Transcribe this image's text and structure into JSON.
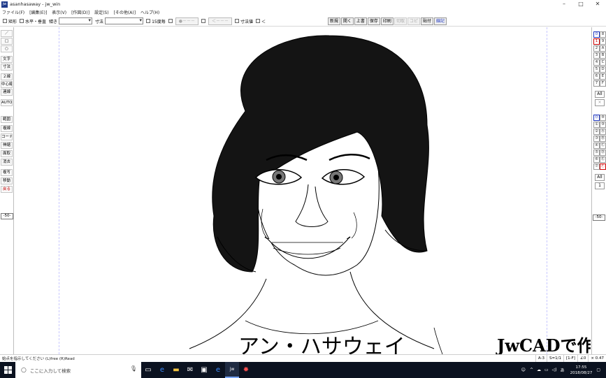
{
  "window": {
    "app_icon_label": "jw",
    "title": "asanhasaway - jw_win",
    "controls": [
      "–",
      "□",
      "✕"
    ]
  },
  "menu": [
    "ファイル(F)",
    "[編集(E)]",
    "表示(V)",
    "[作図(D)]",
    "設定(S)",
    "[その他(A)]",
    "ヘルプ(H)"
  ],
  "toolbar": {
    "rect_label": "矩形",
    "horiz_vert_label": "水平・垂直",
    "tilt_label": "傾き",
    "dim_label": "寸法",
    "deg15_label": "15度毎",
    "btn_disabled_1": "●－－－",
    "btn_disabled_2": "＜－－－",
    "dimvalue_label": "寸法値",
    "lt_label": "＜",
    "buttons": [
      {
        "label": "新規",
        "state": "normal"
      },
      {
        "label": "開く",
        "state": "normal"
      },
      {
        "label": "上書",
        "state": "normal"
      },
      {
        "label": "保存",
        "state": "normal"
      },
      {
        "label": "印刷",
        "state": "normal"
      },
      {
        "label": "切取",
        "state": "disabled"
      },
      {
        "label": "コピ",
        "state": "disabled"
      },
      {
        "label": "貼付",
        "state": "normal"
      },
      {
        "label": "線記",
        "state": "accent"
      }
    ]
  },
  "left_tools": {
    "line": "／",
    "rect": "□",
    "circle": "○",
    "text": "文字",
    "dim": "寸法",
    "double_line": "２線",
    "center_line": "中心線",
    "connect": "連線",
    "auto": "AUTO",
    "range": "範囲",
    "copy_line": "複線",
    "corner": "コーナー",
    "stretch": "伸縮",
    "face": "面取",
    "erase": "消去",
    "duplicate": "複写",
    "move": "移動",
    "undo": "戻る",
    "scale": "-50-"
  },
  "right_layers": {
    "groups_top": [
      [
        "0",
        "8"
      ],
      [
        "1",
        "9"
      ],
      [
        "2",
        "A"
      ],
      [
        "3",
        "B"
      ],
      [
        "4",
        "C"
      ],
      [
        "5",
        "D"
      ],
      [
        "6",
        "E"
      ],
      [
        "7",
        "F"
      ]
    ],
    "all_top": "All",
    "x_top": "×",
    "groups_bottom": [
      [
        "⓪",
        "⑧"
      ],
      [
        "①",
        "⑨"
      ],
      [
        "②",
        "Ⓐ"
      ],
      [
        "③",
        "Ⓑ"
      ],
      [
        "④",
        "Ⓒ"
      ],
      [
        "⑤",
        "Ⓓ"
      ],
      [
        "⑥",
        "Ⓔ"
      ],
      [
        "⑦",
        "Ⓕ"
      ]
    ],
    "all_bottom": "All",
    "one_bottom": "1",
    "scale": "-50-"
  },
  "canvas": {
    "caption_name": "アン・ハサウェイ",
    "caption_brand": "JwCADで作図"
  },
  "status": {
    "message": "始点を指示してください (L)free (R)Read",
    "paper": "A-3",
    "scale": "S=1/1",
    "layer": "[1-F]",
    "angle": "∠0",
    "zoom": "× 0.47"
  },
  "taskbar": {
    "search_placeholder": "ここに入力して検索",
    "time": "17:55",
    "date": "2018/08/27",
    "colors": {
      "bar": "#0b1220",
      "highlight": "#7aa7ff"
    }
  }
}
